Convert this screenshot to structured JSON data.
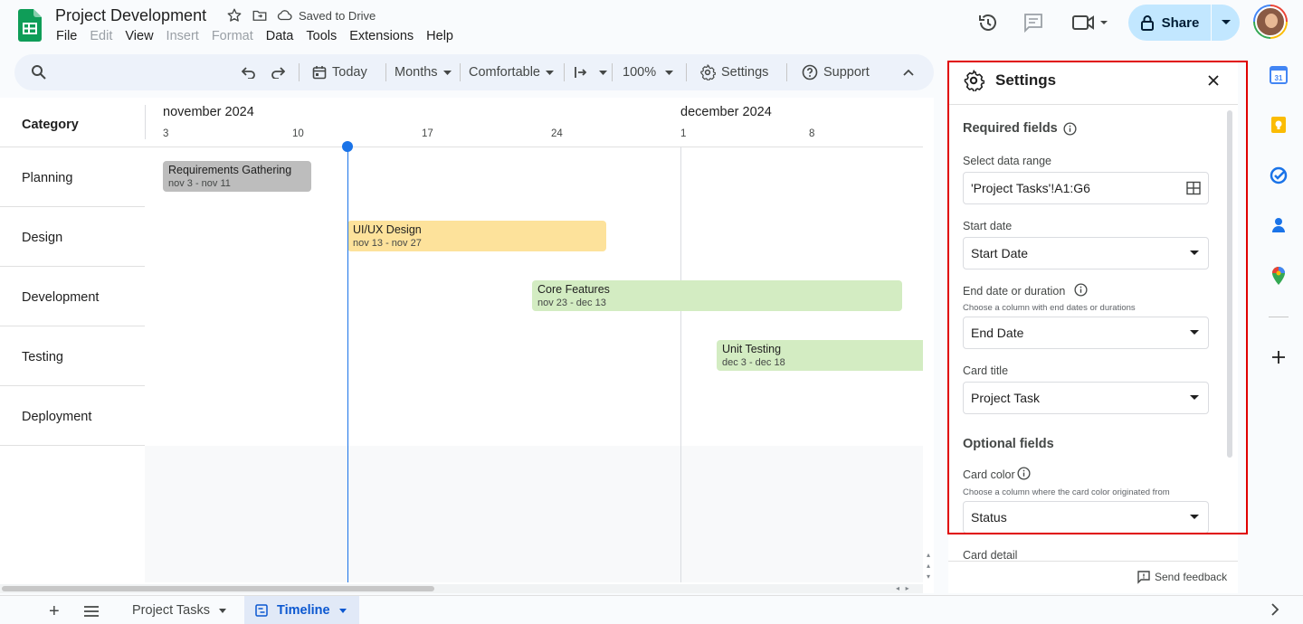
{
  "doc": {
    "title": "Project Development",
    "saved_status": "Saved to Drive"
  },
  "menu": [
    "File",
    "Edit",
    "View",
    "Insert",
    "Format",
    "Data",
    "Tools",
    "Extensions",
    "Help"
  ],
  "menu_disabled": [
    "Edit",
    "Insert",
    "Format"
  ],
  "share": {
    "label": "Share",
    "color": "#c2e7ff"
  },
  "toolbar": {
    "today": "Today",
    "months": "Months",
    "density": "Comfortable",
    "zoom": "100%",
    "settings": "Settings",
    "support": "Support"
  },
  "timeline": {
    "category_header": "Category",
    "months": [
      "november 2024",
      "december 2024"
    ],
    "days": [
      "3",
      "10",
      "17",
      "24",
      "1",
      "8"
    ],
    "rows": [
      {
        "label": "Planning"
      },
      {
        "label": "Design"
      },
      {
        "label": "Development"
      },
      {
        "label": "Testing"
      },
      {
        "label": "Deployment"
      }
    ],
    "cards": [
      {
        "title": "Requirements Gathering",
        "dates": "nov 3 - nov 11",
        "color": "#bdbdbd"
      },
      {
        "title": "UI/UX Design",
        "dates": "nov 13 - nov 27",
        "color": "#fde29b"
      },
      {
        "title": "Core Features",
        "dates": "nov 23 - dec 13",
        "color": "#d3ecc2"
      },
      {
        "title": "Unit Testing",
        "dates": "dec 3 - dec 18",
        "color": "#d3ecc2"
      }
    ],
    "today_color": "#1a73e8"
  },
  "settings": {
    "title": "Settings",
    "required_header": "Required fields",
    "data_range_label": "Select data range",
    "data_range_value": "'Project Tasks'!A1:G6",
    "start_date_label": "Start date",
    "start_date_value": "Start Date",
    "end_date_label": "End date or duration",
    "end_date_hint": "Choose a column with end dates or durations",
    "end_date_value": "End Date",
    "card_title_label": "Card title",
    "card_title_value": "Project Task",
    "optional_header": "Optional fields",
    "card_color_label": "Card color",
    "card_color_hint": "Choose a column where the card color originated from",
    "card_color_value": "Status",
    "card_detail_label": "Card detail",
    "feedback": "Send feedback",
    "highlight_color": "#e00000"
  },
  "sheets": {
    "tabs": [
      {
        "label": "Project Tasks",
        "active": false
      },
      {
        "label": "Timeline",
        "active": true
      }
    ]
  }
}
